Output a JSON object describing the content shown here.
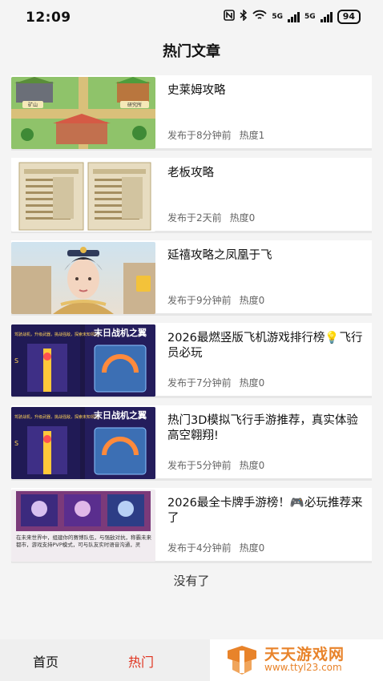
{
  "status_bar": {
    "time": "12:09",
    "battery": "94",
    "signal1": "5G",
    "signal2": "5G"
  },
  "header": {
    "title": "热门文章"
  },
  "articles": [
    {
      "title": "史莱姆攻略",
      "published": "发布于8分钟前",
      "heat": "热度1",
      "thumb_icon": "slime-game-map-image"
    },
    {
      "title": "老板攻略",
      "published": "发布于2天前",
      "heat": "热度0",
      "thumb_icon": "boss-guide-screens-image"
    },
    {
      "title": "延禧攻略之凤凰于飞",
      "published": "发布于9分钟前",
      "heat": "热度0",
      "thumb_icon": "palace-lady-portrait-image"
    },
    {
      "title": "2026最燃竖版飞机游戏排行榜💡飞行员必玩",
      "published": "发布于7分钟前",
      "heat": "热度0",
      "thumb_icon": "shooter-game-screens-image"
    },
    {
      "title": "热门3D模拟飞行手游推荐，真实体验高空翱翔!",
      "published": "发布于5分钟前",
      "heat": "热度0",
      "thumb_icon": "shooter-game-screens-image"
    },
    {
      "title": "2026最全卡牌手游榜！🎮必玩推荐来了",
      "published": "发布于4分钟前",
      "heat": "热度0",
      "thumb_icon": "card-game-screens-image"
    }
  ],
  "thumb_text": {
    "map_left": "矿山",
    "map_right": "研究所",
    "shooter_banner": "末日战机之翼",
    "shooter_sub": "驾驶战机，升级武器，挑战强敌，探索未知领空。",
    "card_desc": "在未来世界中，组建你的赛博队伍，与强敌对抗，称霸未来都市，游戏支持PVP模式，可与队友实时语音沟通，灵"
  },
  "list_end": "没有了",
  "tabbar": {
    "home": "首页",
    "hot": "热门"
  },
  "watermark": {
    "name": "天天游戏网",
    "url": "www.ttyl23.com"
  },
  "colors": {
    "accent": "#e0321e",
    "watermark": "#e8832a"
  }
}
